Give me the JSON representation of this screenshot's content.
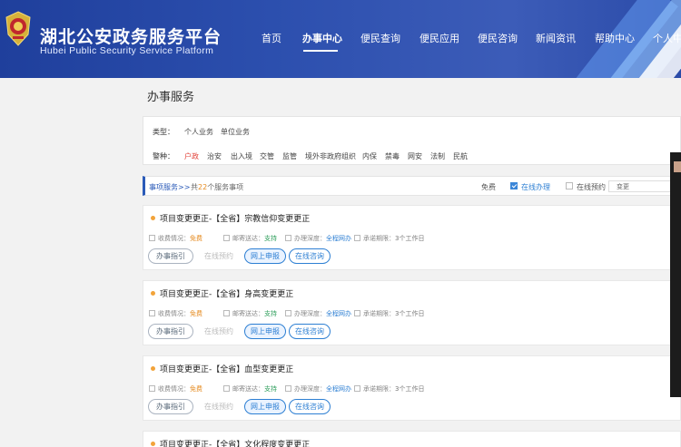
{
  "header": {
    "title": "湖北公安政务服务平台",
    "subtitle": "Hubei Public Security Service Platform",
    "nav": [
      {
        "label": "首页",
        "active": false
      },
      {
        "label": "办事中心",
        "active": true
      },
      {
        "label": "便民查询",
        "active": false
      },
      {
        "label": "便民应用",
        "active": false
      },
      {
        "label": "便民咨询",
        "active": false
      },
      {
        "label": "新闻资讯",
        "active": false
      },
      {
        "label": "帮助中心",
        "active": false
      },
      {
        "label": "个人中",
        "active": false
      }
    ]
  },
  "page_title": "办事服务",
  "filters": {
    "type_label": "类型：",
    "type_options": [
      "个人业务",
      "单位业务"
    ],
    "police_label": "警种：",
    "police_options": [
      "户政",
      "治安",
      "出入境",
      "交管",
      "监管",
      "境外非政府组织",
      "内保",
      "禁毒",
      "网安",
      "法制",
      "民航"
    ]
  },
  "results_bar": {
    "crumb": "事项服务>>",
    "count_prefix": "共",
    "count": "22",
    "count_suffix": "个服务事项",
    "free_label": "免费",
    "online_label": "在线办理",
    "reserve_label": "在线预约",
    "search_value": "变更"
  },
  "cards": [
    {
      "name": "项目变更更正-【全省】宗教信仰变更更正",
      "fee_label": "收费情况：",
      "fee_value": "免费",
      "mail_label": "邮寄送达：",
      "mail_value": "支持",
      "depth_label": "办理深度：",
      "depth_value": "全程网办",
      "time_label": "承诺期限：",
      "time_value": "3个工作日",
      "buttons": [
        "办事指引",
        "在线预约",
        "网上申报",
        "在线咨询"
      ]
    },
    {
      "name": "项目变更更正-【全省】身高变更更正",
      "fee_label": "收费情况：",
      "fee_value": "免费",
      "mail_label": "邮寄送达：",
      "mail_value": "支持",
      "depth_label": "办理深度：",
      "depth_value": "全程网办",
      "time_label": "承诺期限：",
      "time_value": "3个工作日",
      "buttons": [
        "办事指引",
        "在线预约",
        "网上申报",
        "在线咨询"
      ]
    },
    {
      "name": "项目变更更正-【全省】血型变更更正",
      "fee_label": "收费情况：",
      "fee_value": "免费",
      "mail_label": "邮寄送达：",
      "mail_value": "支持",
      "depth_label": "办理深度：",
      "depth_value": "全程网办",
      "time_label": "承诺期限：",
      "time_value": "3个工作日",
      "buttons": [
        "办事指引",
        "在线预约",
        "网上申报",
        "在线咨询"
      ]
    },
    {
      "name": "项目变更更正-【全省】文化程度变更更正"
    }
  ]
}
